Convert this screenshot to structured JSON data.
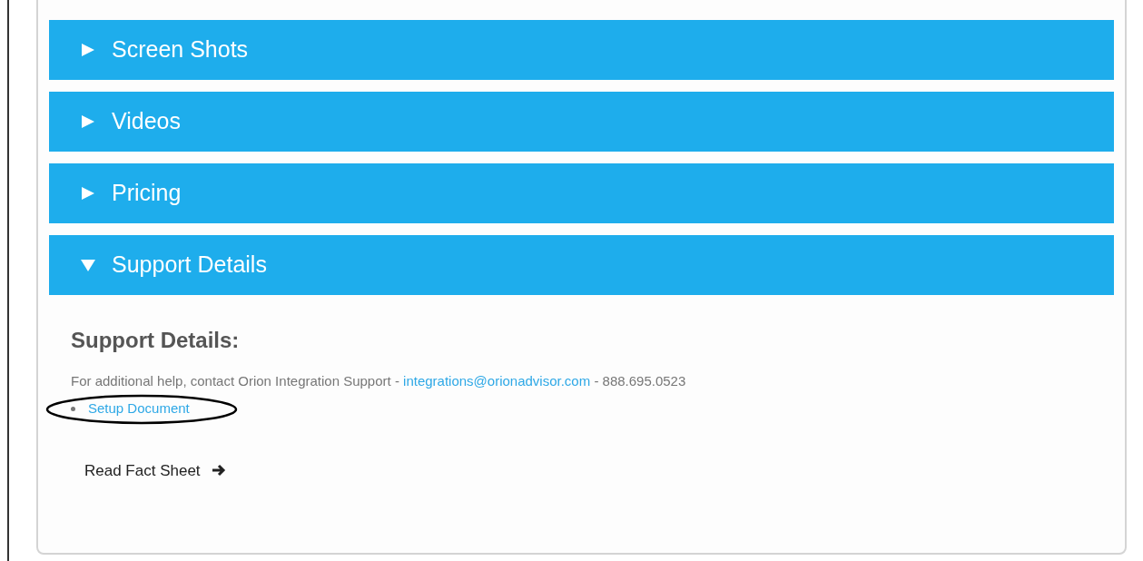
{
  "accordion": [
    {
      "title": "Screen Shots",
      "expanded": false
    },
    {
      "title": "Videos",
      "expanded": false
    },
    {
      "title": "Pricing",
      "expanded": false
    },
    {
      "title": "Support Details",
      "expanded": true
    }
  ],
  "support": {
    "heading": "Support Details:",
    "text": "For additional help, contact Orion Integration Support - ",
    "email": "integrations@orionadvisor.com",
    "phone": " - 888.695.0523",
    "links": [
      {
        "label": "Setup Document",
        "circled": true
      }
    ]
  },
  "fact_sheet_link": "Read Fact Sheet"
}
